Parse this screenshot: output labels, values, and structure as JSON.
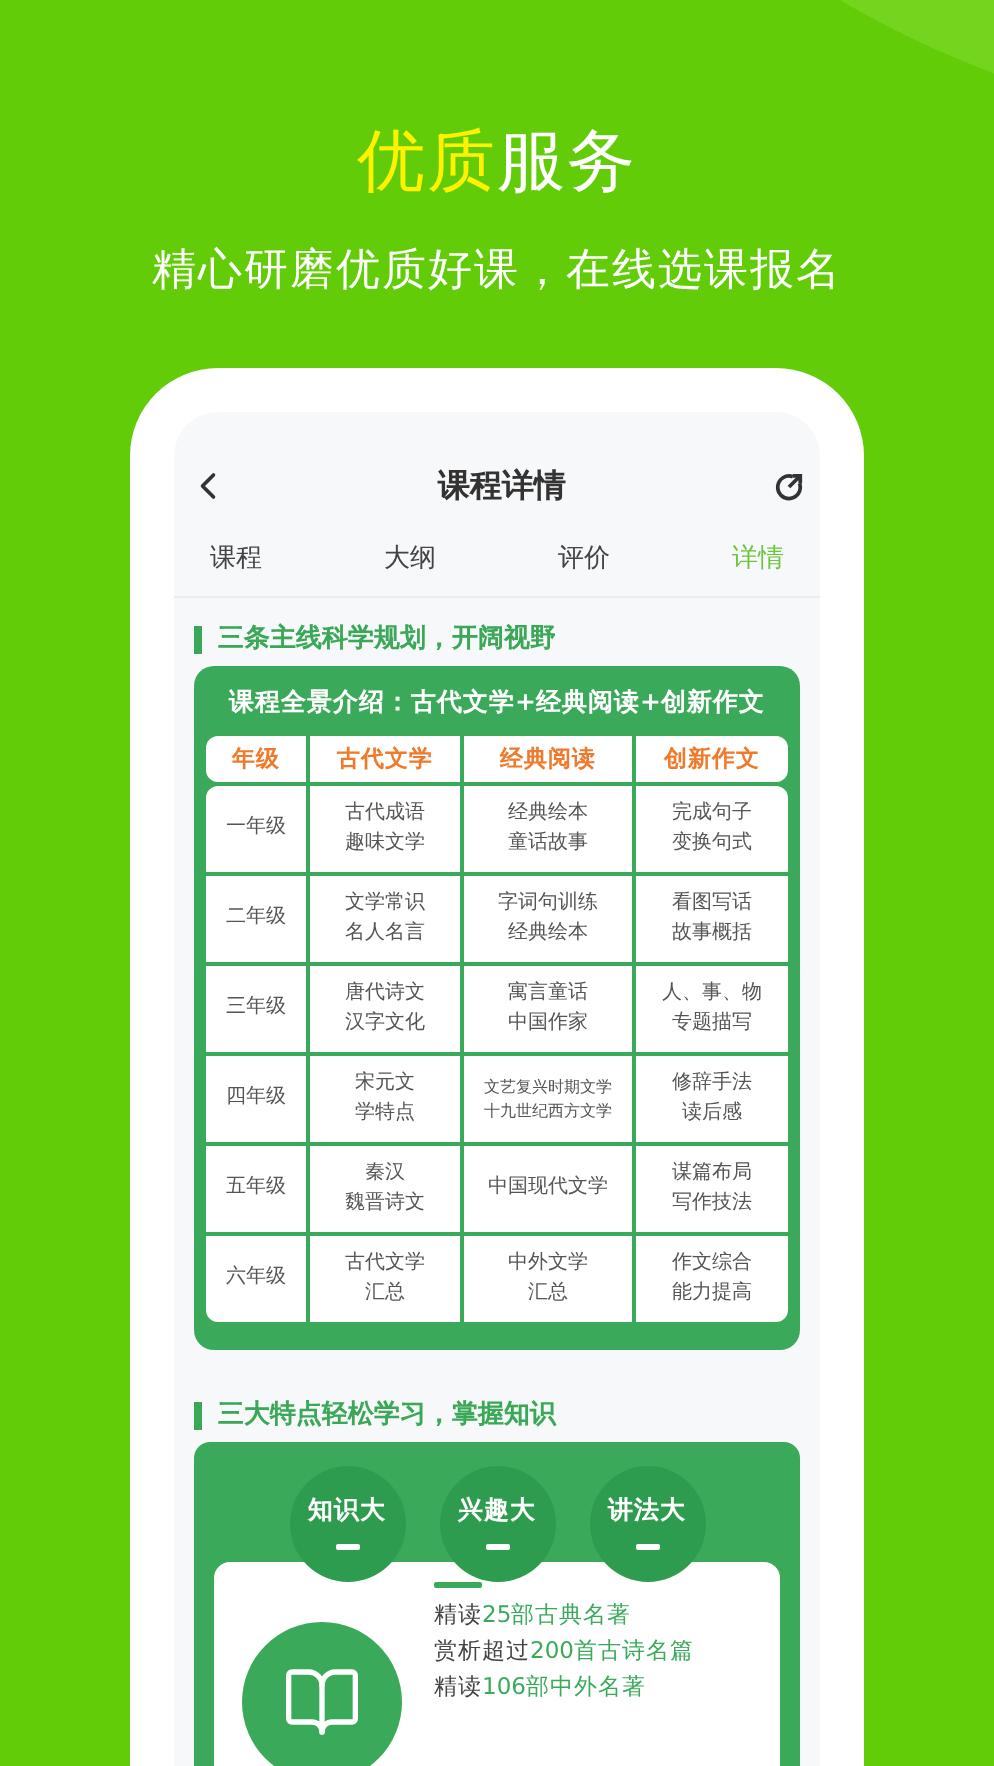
{
  "hero": {
    "title": [
      {
        "text": "优质",
        "highlight": true
      },
      {
        "text": "服务",
        "highlight": false
      }
    ],
    "subtitle": "精心研磨优质好课，在线选课报名"
  },
  "screen": {
    "title": "课程详情",
    "tabs": [
      {
        "label": "课程",
        "selected": false
      },
      {
        "label": "大纲",
        "selected": false
      },
      {
        "label": "评价",
        "selected": false
      },
      {
        "label": "详情",
        "selected": true
      }
    ],
    "section_1": {
      "heading": "三条主线科学规划，开阔视野",
      "table": {
        "caption": "课程全景介绍：古代文学+经典阅读+创新作文",
        "columns": [
          "年级",
          "古代文学",
          "经典阅读",
          "创新作文"
        ],
        "rows": [
          [
            [
              "一年级"
            ],
            [
              "古代成语",
              "趣味文学"
            ],
            [
              "经典绘本",
              "童话故事"
            ],
            [
              "完成句子",
              "变换句式"
            ]
          ],
          [
            [
              "二年级"
            ],
            [
              "文学常识",
              "名人名言"
            ],
            [
              "字词句训练",
              "经典绘本"
            ],
            [
              "看图写话",
              "故事概括"
            ]
          ],
          [
            [
              "三年级"
            ],
            [
              "唐代诗文",
              "汉字文化"
            ],
            [
              "寓言童话",
              "中国作家"
            ],
            [
              "人、事、物",
              "专题描写"
            ]
          ],
          [
            [
              "四年级"
            ],
            [
              "宋元文",
              "学特点"
            ],
            [
              "文艺复兴时期文学",
              "十九世纪西方文学"
            ],
            [
              "修辞手法",
              "读后感"
            ]
          ],
          [
            [
              "五年级"
            ],
            [
              "秦汉",
              "魏晋诗文"
            ],
            [
              "中国现代文学"
            ],
            [
              "谋篇布局",
              "写作技法"
            ]
          ],
          [
            [
              "六年级"
            ],
            [
              "古代文学",
              "汇总"
            ],
            [
              "中外文学",
              "汇总"
            ],
            [
              "作文综合",
              "能力提高"
            ]
          ]
        ]
      }
    },
    "section_2": {
      "heading": "三大特点轻松学习，掌握知识",
      "features": [
        "知识大",
        "兴趣大",
        "讲法大"
      ],
      "lines": [
        [
          {
            "text": "精读",
            "highlight": false
          },
          {
            "text": "25部古典名著",
            "highlight": true
          }
        ],
        [
          {
            "text": "赏析超过",
            "highlight": false
          },
          {
            "text": "200首古诗名篇",
            "highlight": true
          }
        ],
        [
          {
            "text": "精读",
            "highlight": false
          },
          {
            "text": "106部中外名著",
            "highlight": true
          }
        ]
      ]
    }
  }
}
